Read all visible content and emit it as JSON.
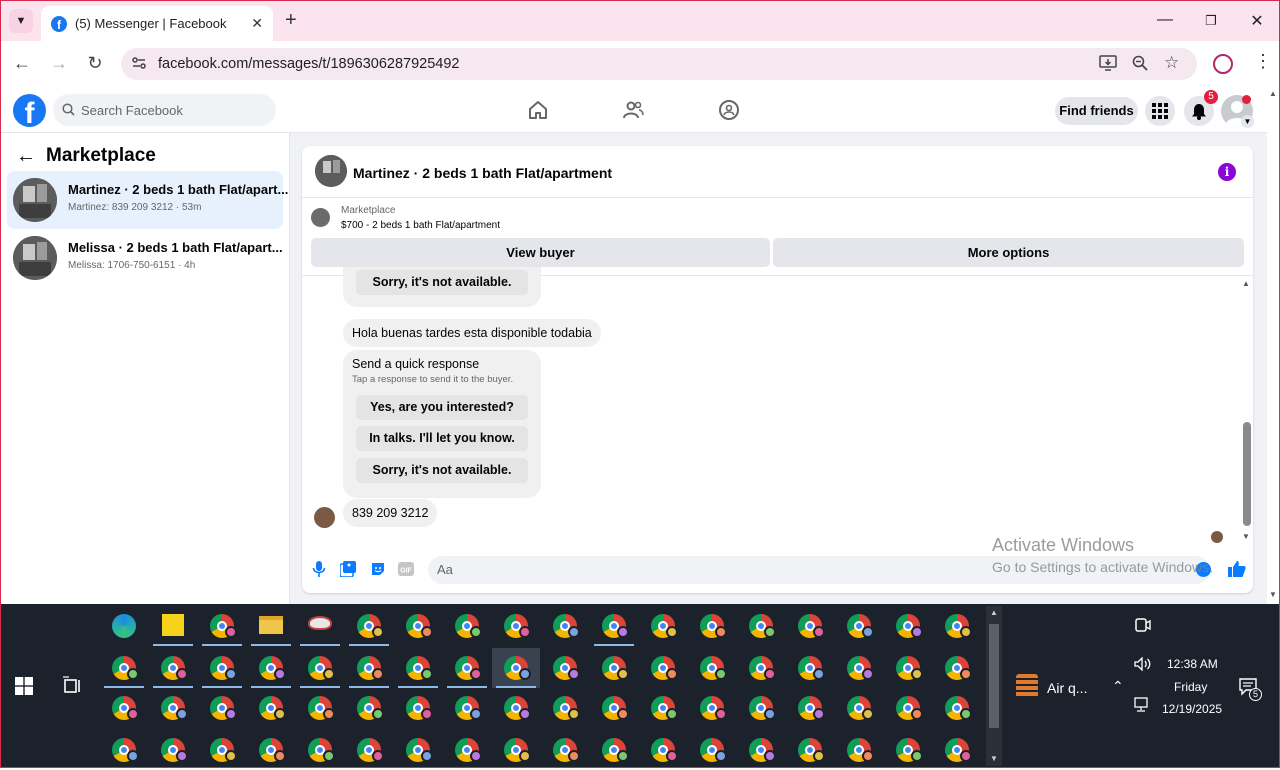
{
  "browser": {
    "tab_title": "(5) Messenger | Facebook",
    "url": "facebook.com/messages/t/1896306287925492"
  },
  "facebook": {
    "search_placeholder": "Search Facebook",
    "find_friends": "Find friends",
    "notification_count": "5"
  },
  "sidebar": {
    "title": "Marketplace",
    "conversations": [
      {
        "name": "Martinez · 2 beds 1 bath Flat/apart...",
        "sub": "Martinez: 839 209 3212 · 53m",
        "active": true
      },
      {
        "name": "Melissa · 2 beds 1 bath Flat/apart...",
        "sub": "Melissa: 1706-750-6151 · 4h",
        "active": false
      }
    ]
  },
  "chat": {
    "title": "Martinez · 2 beds 1 bath Flat/apartment",
    "marketplace_label": "Marketplace",
    "listing": "$700 - 2 beds 1 bath Flat/apartment",
    "view_buyer": "View buyer",
    "more_options": "More options",
    "messages": {
      "top_quick": "Sorry, it's not available.",
      "incoming_1": "Hola  buenas tardes  esta disponible  todabia",
      "quick_title": "Send a quick response",
      "quick_sub": "Tap a response to send it to the buyer.",
      "quick_options": [
        "Yes, are you interested?",
        "In talks. I'll let you know.",
        "Sorry, it's not available."
      ],
      "incoming_2": "839 209 3212"
    },
    "composer_placeholder": "Aa"
  },
  "watermark": {
    "line1": "Activate Windows",
    "line2": "Go to Settings to activate Windows."
  },
  "taskbar": {
    "weather": "Air q...",
    "time": "12:38 AM",
    "day": "Friday",
    "date": "12/19/2025",
    "notif_count": "5"
  },
  "colors": {
    "fb_blue": "#1877f2",
    "accent_purple": "#8a05d8",
    "chrome_tint": "#fce4ef",
    "taskbar_bg": "#1b222c"
  }
}
